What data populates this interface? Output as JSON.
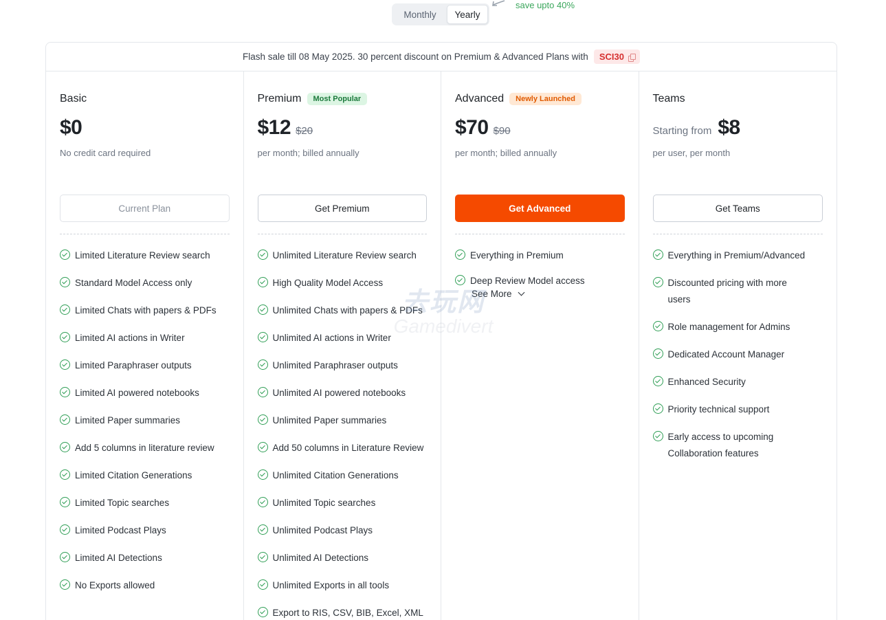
{
  "billing": {
    "monthly_label": "Monthly",
    "yearly_label": "Yearly",
    "selected": "Yearly",
    "save_note": "save upto 40%"
  },
  "banner": {
    "text": "Flash sale till 08 May 2025. 30 percent discount on Premium & Advanced Plans with",
    "coupon_code": "SCI30"
  },
  "plans": [
    {
      "name": "Basic",
      "badge": "",
      "prefix": "",
      "price": "$0",
      "old_price": "",
      "note": "No credit card required",
      "cta": "Current Plan",
      "features": [
        "Limited Literature Review search",
        "Standard Model Access only",
        "Limited Chats with papers & PDFs",
        "Limited AI actions in Writer",
        "Limited Paraphraser outputs",
        "Limited AI powered notebooks",
        "Limited Paper summaries",
        "Add 5 columns in literature review",
        "Limited Citation Generations",
        "Limited Topic searches",
        "Limited Podcast Plays",
        "Limited AI Detections",
        "No Exports allowed"
      ]
    },
    {
      "name": "Premium",
      "badge": "Most Popular",
      "prefix": "",
      "price": "$12",
      "old_price": "$20",
      "note": "per month; billed annually",
      "cta": "Get Premium",
      "features": [
        "Unlimited Literature Review search",
        "High Quality Model Access",
        "Unlimited Chats with papers & PDFs",
        "Unlimited AI actions in Writer",
        "Unlimited Paraphraser outputs",
        "Unlimited AI powered notebooks",
        "Unlimited Paper summaries",
        "Add 50 columns in Literature Review",
        "Unlimited Citation Generations",
        "Unlimited Topic searches",
        "Unlimited Podcast Plays",
        "Unlimited AI Detections",
        "Unlimited Exports in all tools",
        "Export to RIS, CSV, BIB, Excel, XML"
      ]
    },
    {
      "name": "Advanced",
      "badge": "Newly Launched",
      "prefix": "",
      "price": "$70",
      "old_price": "$90",
      "note": "per month; billed annually",
      "cta": "Get Advanced",
      "features": [
        "Everything in Premium",
        "Deep Review Model access"
      ],
      "see_more": "See More"
    },
    {
      "name": "Teams",
      "badge": "",
      "prefix": "Starting from",
      "price": "$8",
      "old_price": "",
      "note": "per user, per month",
      "cta": "Get Teams",
      "features": [
        "Everything in Premium/Advanced",
        "Discounted pricing with more users",
        "Role management for Admins",
        "Dedicated Account Manager",
        "Enhanced Security",
        "Priority technical support",
        "Early access to upcoming Collaboration features"
      ]
    }
  ],
  "watermark": {
    "line1": "去玩网",
    "line2": "Gamedivert"
  },
  "colors": {
    "accent": "#f54a00",
    "check": "#2f9e55",
    "save_note": "#3aa65b",
    "coupon": "#d62f2f"
  }
}
